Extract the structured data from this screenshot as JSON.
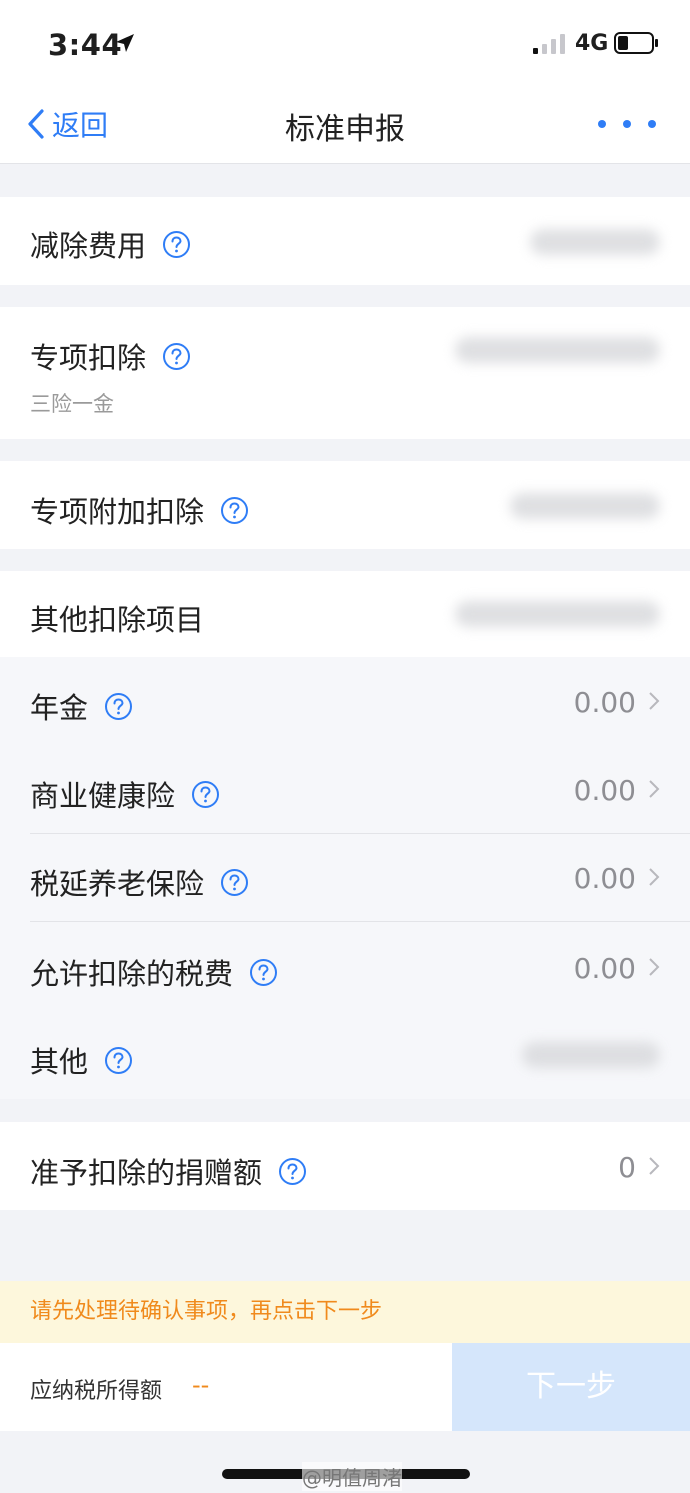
{
  "status": {
    "time": "3:44",
    "network": "4G",
    "icons": [
      "location-arrow-icon",
      "signal-icon",
      "battery-icon"
    ]
  },
  "nav": {
    "back_label": "返回",
    "title": "标准申报",
    "more_icon": "more-dots-icon"
  },
  "rows": {
    "jianchu": {
      "label": "减除费用"
    },
    "zhuanxiang": {
      "label": "专项扣除",
      "sub": "三险一金"
    },
    "fujia": {
      "label": "专项附加扣除"
    },
    "qita_header": {
      "label": "其他扣除项目"
    },
    "nianjin": {
      "label": "年金",
      "value": "0.00"
    },
    "shangye": {
      "label": "商业健康险",
      "value": "0.00"
    },
    "shuiyan": {
      "label": "税延养老保险",
      "value": "0.00"
    },
    "yunxu": {
      "label": "允许扣除的税费",
      "value": "0.00"
    },
    "qita": {
      "label": "其他"
    },
    "juanzeng": {
      "label": "准予扣除的捐赠额",
      "value": "0"
    }
  },
  "notice": {
    "text": "请先处理待确认事项，再点击下一步"
  },
  "bottom": {
    "tax_label": "应纳税所得额",
    "tax_value": "--",
    "next_label": "下一步"
  },
  "watermark": "@明值周渚",
  "colors": {
    "accent": "#2f7df6",
    "warning": "#f08a1c",
    "notice_bg": "#fdf7dc",
    "next_btn_bg": "#d5e6fb"
  }
}
